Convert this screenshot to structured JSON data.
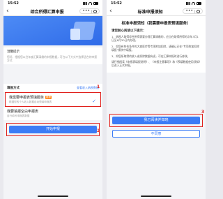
{
  "left": {
    "status": {
      "time": "15:52"
    },
    "nav": {
      "back": "‹",
      "title": "综合所得汇算申报",
      "more": "•••"
    },
    "tips": {
      "title": "温馨提示",
      "text": "您好，根据您以往年度汇算清缴的申报数据，可在以下方式中选择适合的申报方式"
    },
    "section": {
      "title": "填报方式",
      "link": "查看收入纳税数据"
    },
    "options": [
      {
        "title": "我需要申报表预填服务",
        "badge": "推荐",
        "desc": "根据您的个人收入数据自动预填申报表",
        "checked": true
      },
      {
        "title": "我要填报空白申报表",
        "badge": "",
        "desc": "自行填写申报表数据",
        "checked": false
      }
    ],
    "start_button": "开始申报",
    "markers": [
      "1",
      "2"
    ]
  },
  "right": {
    "status": {
      "time": "15:52"
    },
    "nav": {
      "back": "‹",
      "title": "标准申报须知",
      "more": "•••"
    },
    "notice": {
      "title": "标准申报须知（我需要申报表预填服务）",
      "lead": "请您耐心阅读以下提示：",
      "paragraphs": [
        "1、纳税人取得综合所得需要办理汇算清缴的，应当在取得所得的次年3月1日至6月30日内办理。",
        "2、如您有符合条件的大病医疗等专项附加扣除，请确认已在“专项附加扣除填报”模块中填报。",
        "3、如您所取得的收入或扣除数据有误，可在汇算申报时进行修改。",
        "请仔细阅读《申报表填报说明》、《申报注意事项》和《预填数据使用须知》后进入正式申报。"
      ]
    },
    "read_button": "我已阅读并知晓",
    "decline_button": "不同意",
    "markers": [
      "3"
    ]
  },
  "colors": {
    "accent": "#3b7cf6",
    "highlight": "#e0201c",
    "badge": "#ff8a1f"
  }
}
